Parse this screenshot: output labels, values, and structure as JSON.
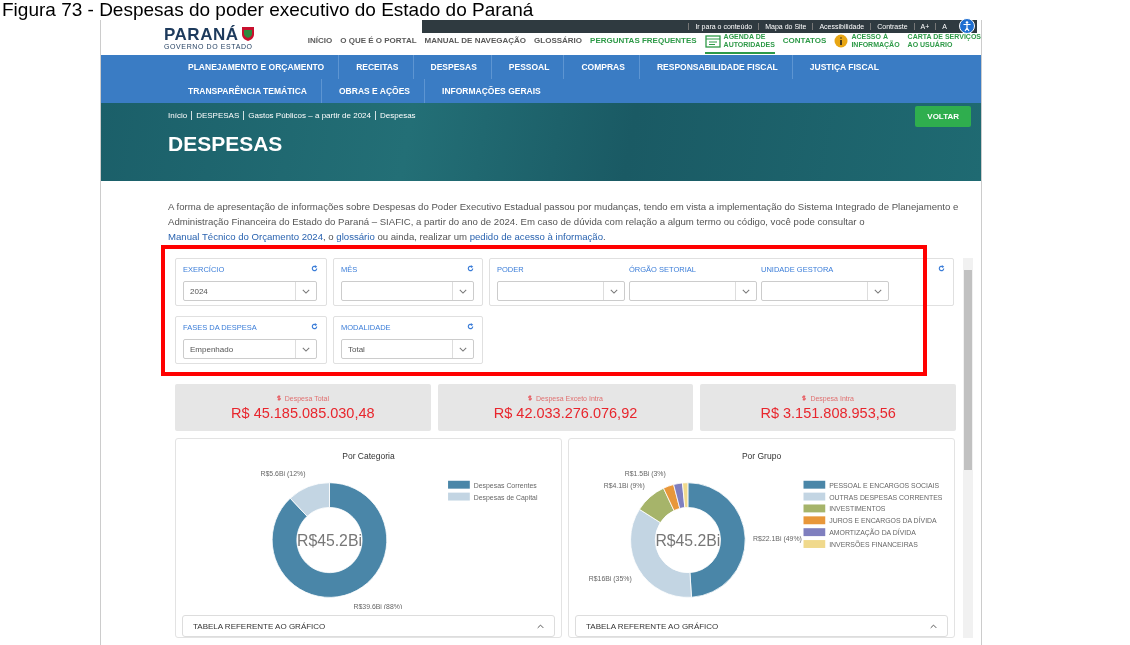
{
  "caption": "Figura 73 - Despesas do poder executivo do Estado do Paraná",
  "utility_links": [
    "Ir para o conteúdo",
    "Mapa do Site",
    "Acessibilidade",
    "Contraste",
    "A+",
    "A"
  ],
  "logo": {
    "name": "PARANÁ",
    "subtitle": "GOVERNO DO ESTADO"
  },
  "top_menu": [
    {
      "lines": [
        "INÍCIO"
      ],
      "kind": "portal",
      "selected": false
    },
    {
      "lines": [
        "O QUE É O PORTAL"
      ],
      "kind": "portal",
      "selected": false
    },
    {
      "lines": [
        "MANUAL DE NAVEGAÇÃO"
      ],
      "kind": "portal",
      "selected": false
    },
    {
      "lines": [
        "GLOSSÁRIO"
      ],
      "kind": "portal",
      "selected": false
    },
    {
      "lines": [
        "PERGUNTAS FREQUENTES"
      ],
      "kind": "service",
      "selected": false
    },
    {
      "lines": [
        "AGENDA DE",
        "AUTORIDADES"
      ],
      "kind": "calendar",
      "selected": true
    },
    {
      "lines": [
        "CONTATOS"
      ],
      "kind": "service",
      "selected": false
    },
    {
      "lines": [
        "ACESSO À",
        "INFORMAÇÃO"
      ],
      "kind": "info",
      "selected": false
    },
    {
      "lines": [
        "CARTA DE SERVIÇOS",
        "AO USUÁRIO"
      ],
      "kind": "service",
      "selected": false
    }
  ],
  "nav_rows": [
    [
      "PLANEJAMENTO E ORÇAMENTO",
      "RECEITAS",
      "DESPESAS",
      "PESSOAL",
      "COMPRAS",
      "RESPONSABILIDADE FISCAL",
      "JUSTIÇA FISCAL"
    ],
    [
      "TRANSPARÊNCIA TEMÁTICA",
      "OBRAS E AÇÕES",
      "INFORMAÇÕES GERAIS"
    ]
  ],
  "breadcrumb": [
    "Início",
    "DESPESAS",
    "Gastos Públicos – a partir de 2024",
    "Despesas"
  ],
  "page_title": "DESPESAS",
  "back_button": "VOLTAR",
  "intro": [
    {
      "kind": "text",
      "text": "A forma de apresentação de informações sobre Despesas do Poder Executivo Estadual passou por mudanças, tendo em vista a implementação do Sistema Integrado de Planejamento e Administração Financeira do Estado do Paraná – SIAFIC, a partir do ano de 2024. Em caso de dúvida com relação a algum termo ou código, você pode consultar o "
    },
    {
      "kind": "link",
      "text": "Manual Técnico do Orçamento 2024"
    },
    {
      "kind": "text",
      "text": ", o "
    },
    {
      "kind": "link",
      "text": "glossário"
    },
    {
      "kind": "text",
      "text": " ou ainda, realizar um "
    },
    {
      "kind": "link",
      "text": "pedido de acesso à informação"
    },
    {
      "kind": "text",
      "text": "."
    }
  ],
  "filters_highlighted": true,
  "filter_rows": [
    [
      {
        "fields": [
          {
            "label": "EXERCÍCIO",
            "value": "2024"
          }
        ]
      },
      {
        "fields": [
          {
            "label": "MÊS"
          }
        ]
      },
      {
        "fields": [
          {
            "label": "PODER"
          },
          {
            "label": "ÓRGÃO SETORIAL"
          },
          {
            "label": "UNIDADE GESTORA"
          }
        ]
      }
    ],
    [
      {
        "fields": [
          {
            "label": "FASES DA DESPESA",
            "value": "Empenhado"
          }
        ]
      },
      {
        "fields": [
          {
            "label": "MODALIDADE",
            "value": "Total"
          }
        ]
      }
    ]
  ],
  "kpis": [
    {
      "label": "Despesa Total",
      "value": "R$ 45.185.085.030,48"
    },
    {
      "label": "Despesa Exceto Intra",
      "value": "R$ 42.033.276.076,92"
    },
    {
      "label": "Despesa Intra",
      "value": "R$ 3.151.808.953,56"
    }
  ],
  "charts": [
    {
      "center_label": "R$45.2Bi",
      "table_header": "TABELA REFERENTE AO GRÁFICO",
      "chart_data": {
        "type": "donut",
        "title": "Por Categoria",
        "categories": [
          "Despesas Correntes",
          "Despesas de Capital"
        ],
        "values": [
          88,
          12
        ],
        "legend": true,
        "colors": [
          "#4a86a8",
          "#c3d5e3"
        ],
        "value_labels": [
          "R$39.6Bi (88%)",
          "R$5.6Bi (12%)"
        ]
      }
    },
    {
      "center_label": "R$45.2Bi",
      "table_header": "TABELA REFERENTE AO GRÁFICO",
      "chart_data": {
        "type": "donut",
        "title": "Por Grupo",
        "categories": [
          "PESSOAL E ENCARGOS SOCIAIS",
          "OUTRAS DESPESAS CORRENTES",
          "INVESTIMENTOS",
          "JUROS E ENCARGOS DA DÍVIDA",
          "AMORTIZAÇÃO DA DÍVIDA",
          "INVERSÕES FINANCEIRAS"
        ],
        "values": [
          49,
          35,
          9,
          3,
          2.5,
          1.5
        ],
        "legend": true,
        "colors": [
          "#4a86a8",
          "#c3d5e3",
          "#a6b46a",
          "#e8973a",
          "#7f7fbf",
          "#f0d98c"
        ],
        "value_labels": [
          "R$22.1Bi (49%)",
          "R$16Bi (35%)",
          "R$4.1Bi (9%)",
          "R$1.5Bi (3%)",
          null,
          null
        ]
      }
    }
  ]
}
